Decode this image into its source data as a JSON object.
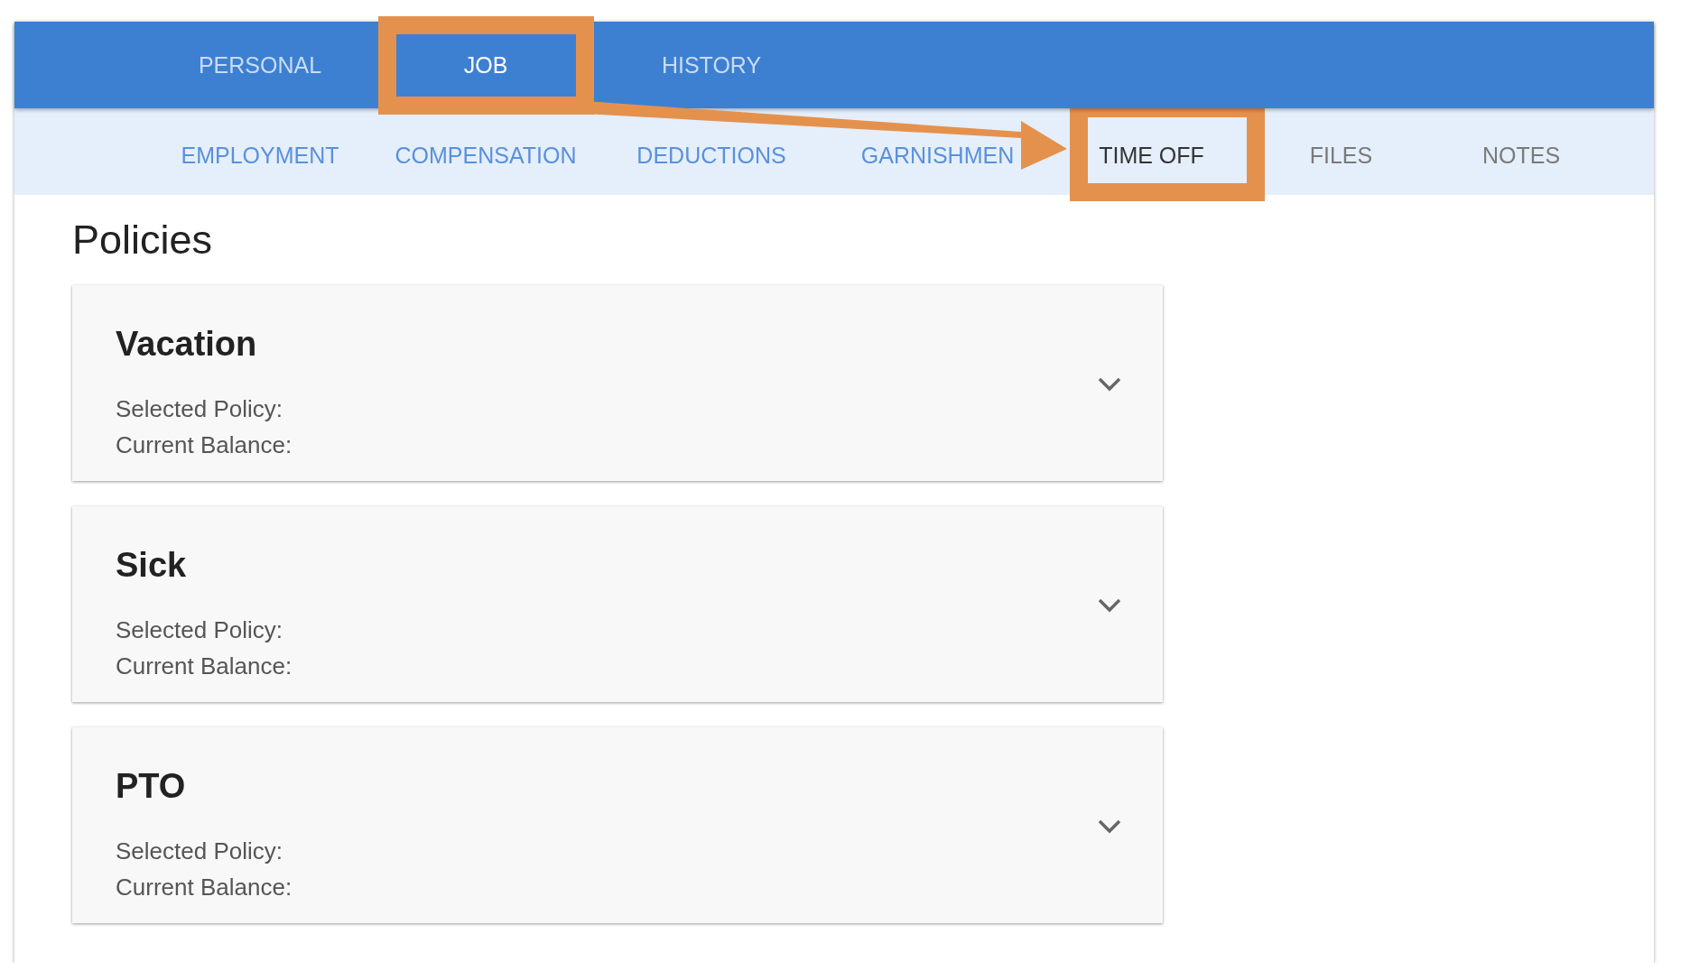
{
  "tabs": [
    {
      "label": "PERSONAL",
      "selected": false,
      "highlighted": false
    },
    {
      "label": "JOB",
      "selected": true,
      "highlighted": true
    },
    {
      "label": "HISTORY",
      "selected": false,
      "highlighted": false
    }
  ],
  "subtabs": [
    {
      "label": "EMPLOYMENT",
      "selected": false,
      "disabled": false,
      "highlighted": false
    },
    {
      "label": "COMPENSATION",
      "selected": false,
      "disabled": false,
      "highlighted": false
    },
    {
      "label": "DEDUCTIONS",
      "selected": false,
      "disabled": false,
      "highlighted": false
    },
    {
      "label": "GARNISHMEN",
      "selected": false,
      "disabled": false,
      "highlighted": false
    },
    {
      "label": "TIME OFF",
      "selected": true,
      "disabled": false,
      "highlighted": true
    },
    {
      "label": "FILES",
      "selected": false,
      "disabled": true,
      "highlighted": false
    },
    {
      "label": "NOTES",
      "selected": false,
      "disabled": true,
      "highlighted": false
    }
  ],
  "callout_arrow": true,
  "heading": "Policies",
  "policies": [
    {
      "title": "Vacation",
      "lines": [
        "Selected Policy:",
        "Current Balance:"
      ],
      "expanded": false
    },
    {
      "title": "Sick",
      "lines": [
        "Selected Policy:",
        "Current Balance:"
      ],
      "expanded": false
    },
    {
      "title": "PTO",
      "lines": [
        "Selected Policy:",
        "Current Balance:"
      ],
      "expanded": false
    }
  ]
}
